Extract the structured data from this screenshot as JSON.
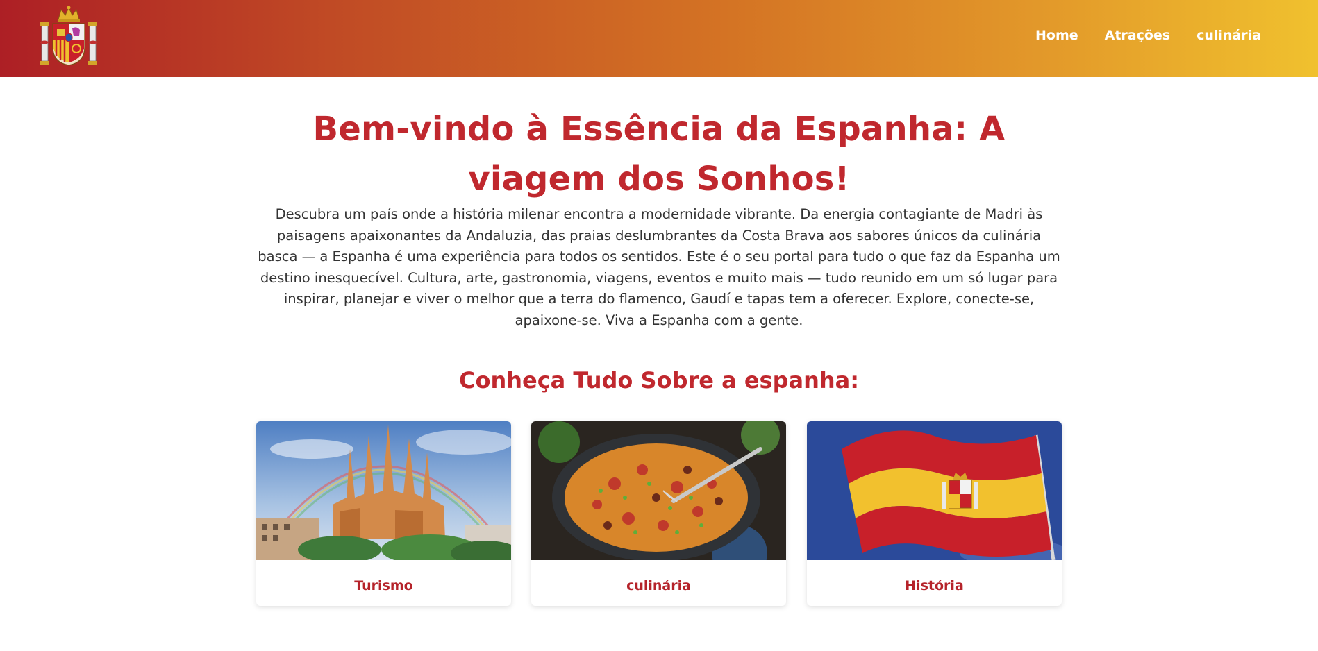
{
  "header": {
    "logo_alt": "Brasão da Espanha",
    "nav": [
      {
        "label": "Home"
      },
      {
        "label": "Atrações"
      },
      {
        "label": "culinária"
      }
    ]
  },
  "hero": {
    "title": "Bem-vindo à Essência da Espanha: A viagem dos Sonhos!",
    "text": "Descubra um país onde a história milenar encontra a modernidade vibrante. Da energia contagiante de Madri às paisagens apaixonantes da Andaluzia, das praias deslumbrantes da Costa Brava aos sabores únicos da culinária basca — a Espanha é uma experiência para todos os sentidos. Este é o seu portal para tudo o que faz da Espanha um destino inesquecível. Cultura, arte, gastronomia, viagens, eventos e muito mais — tudo reunido em um só lugar para inspirar, planejar e viver o melhor que a terra do flamenco, Gaudí e tapas tem a oferecer. Explore, conecte-se, apaixone-se. Viva a Espanha com a gente."
  },
  "section": {
    "title": "Conheça Tudo Sobre a espanha:"
  },
  "cards": [
    {
      "label": "Turismo",
      "image": "sagrada-familia-image"
    },
    {
      "label": "culinária",
      "image": "paella-image"
    },
    {
      "label": "História",
      "image": "spain-flag-image"
    }
  ],
  "colors": {
    "accent": "#c0282e",
    "header_gradient_start": "#ad1f25",
    "header_gradient_end": "#f0c12e"
  }
}
